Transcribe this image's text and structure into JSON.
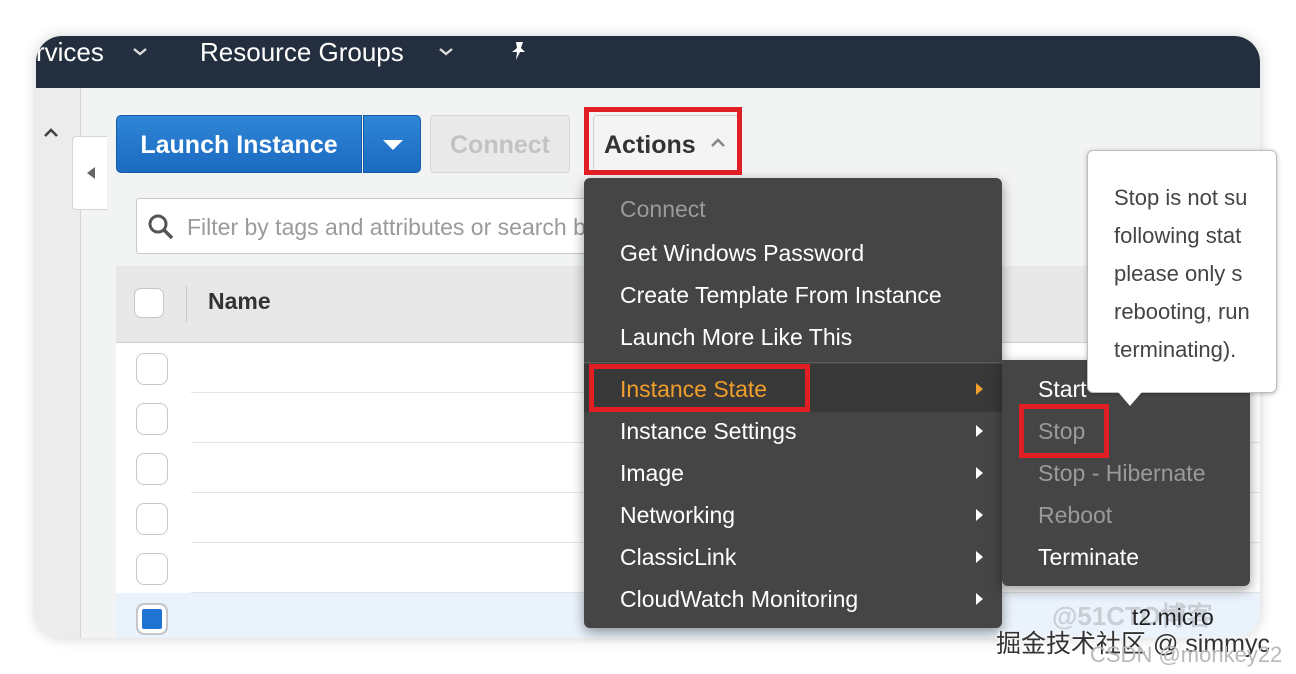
{
  "nav": {
    "services_partial": "rvices",
    "resource_groups": "Resource Groups"
  },
  "toolbar": {
    "launch_instance": "Launch Instance",
    "connect": "Connect",
    "actions": "Actions"
  },
  "filter": {
    "placeholder": "Filter by tags and attributes or search by keyword"
  },
  "table": {
    "header_name": "Name",
    "instance_type_visible": "t2.micro"
  },
  "actions_menu": {
    "items": [
      {
        "label": "Connect",
        "enabled": false
      },
      {
        "label": "Get Windows Password",
        "enabled": true
      },
      {
        "label": "Create Template From Instance",
        "enabled": true
      },
      {
        "label": "Launch More Like This",
        "enabled": true
      },
      {
        "label": "Instance State",
        "enabled": true,
        "submenu": true,
        "active": true
      },
      {
        "label": "Instance Settings",
        "enabled": true,
        "submenu": true
      },
      {
        "label": "Image",
        "enabled": true,
        "submenu": true
      },
      {
        "label": "Networking",
        "enabled": true,
        "submenu": true
      },
      {
        "label": "ClassicLink",
        "enabled": true,
        "submenu": true
      },
      {
        "label": "CloudWatch Monitoring",
        "enabled": true,
        "submenu": true
      }
    ]
  },
  "instance_state_menu": {
    "items": [
      {
        "label": "Start",
        "enabled": true
      },
      {
        "label": "Stop",
        "enabled": false
      },
      {
        "label": "Stop - Hibernate",
        "enabled": false
      },
      {
        "label": "Reboot",
        "enabled": false
      },
      {
        "label": "Terminate",
        "enabled": true
      }
    ]
  },
  "tooltip": {
    "lines": [
      "Stop is not su",
      "following stat",
      "please only s",
      "rebooting, run",
      "terminating)."
    ]
  },
  "watermarks": {
    "faint": "@51CTO博客",
    "main": "掘金技术社区 @ simmyc",
    "csdn": "CSDN @monkey22"
  },
  "colors": {
    "nav_bg": "#232f3e",
    "primary_button": "#1b6ac1",
    "menu_bg": "#454545",
    "active_item": "#f19e2b",
    "highlight_box": "#e01e24"
  }
}
